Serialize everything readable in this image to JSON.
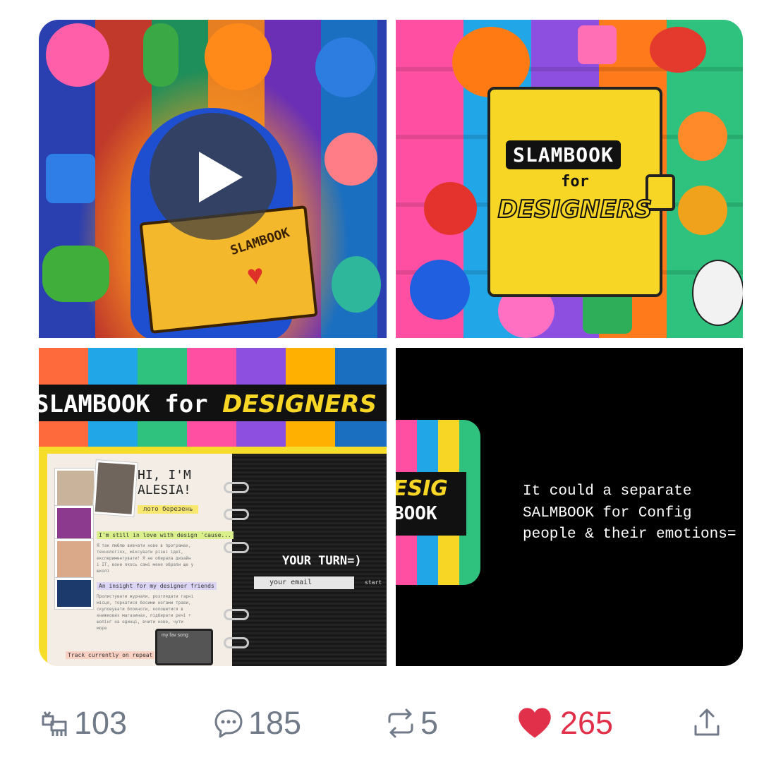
{
  "media": {
    "video_tile": {
      "book_label": "SLAMBOOK",
      "play_label": "play"
    },
    "cover_tile": {
      "title": "SLAMBOOK",
      "for": "for",
      "highlight": "DESIGNERS"
    },
    "site_tile": {
      "banner_main": "SLAMBOOK for ",
      "banner_highlight": "DESIGNERS",
      "greeting_line1": "HI, I'M",
      "greeting_line2": "ALESIA!",
      "handle": "лото березень",
      "note1": "I'm still in love with design 'cause...",
      "para1": "Я так люблю вивчати нове в програмах, технологіях, міксувати різні ідеї, експериментувати! Я не обирала дизайн і IT, вони якось самі мене обрали ще у школі",
      "note2": "An insight for my designer friends",
      "para2": "Пролистувати журнали, розглядати гарні місця, торкатися босими ногами трави, скуповувати блокноти, копошитися в книжкових магазинах, підбирати речі + шопінг на одинці, вчити нове, чути море",
      "note3": "Track currently on repeat",
      "cassette_label": "my fav song",
      "your_turn": "YOUR TURN=)",
      "email_placeholder": "your email",
      "start": "start"
    },
    "text_tile": {
      "mini_highlight": "ESIG",
      "mini_title": "BOOK",
      "caption_line1": "It could a separate",
      "caption_line2": "SALMBOOK for Config",
      "caption_line3": "people & their emotions="
    }
  },
  "actions": {
    "views": "103",
    "replies": "185",
    "reposts": "5",
    "likes": "265"
  },
  "colors": {
    "like": "#e0304a",
    "meta": "#717a88"
  }
}
